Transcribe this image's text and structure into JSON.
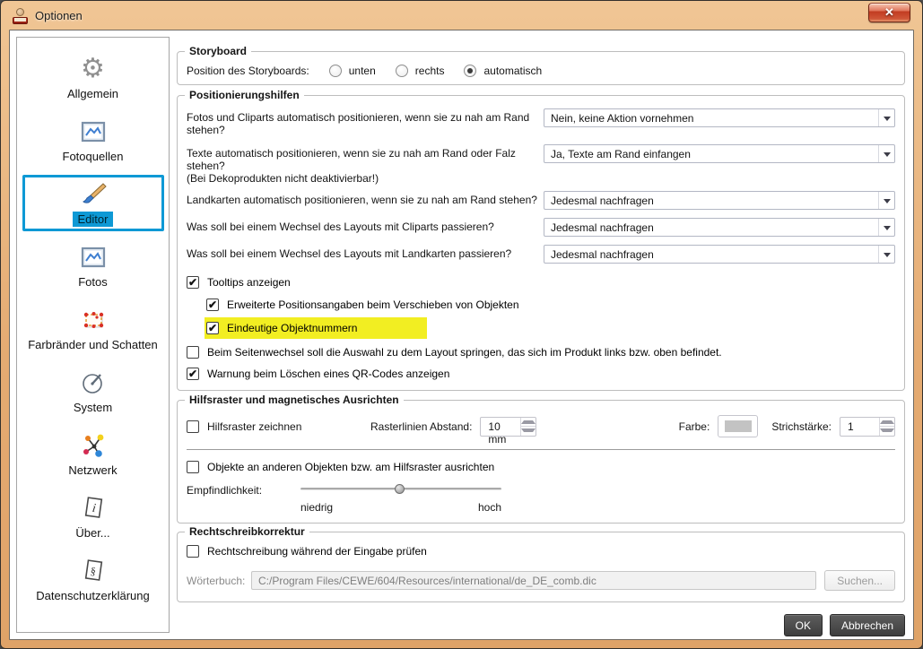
{
  "window": {
    "title": "Optionen",
    "close": "x"
  },
  "colors": {
    "accent_blue": "#0e99d5",
    "highlight_yellow": "#f2ee22",
    "titlebar_orange": "#e5ab72",
    "close_red": "#c23c22",
    "dark_button": "#4a4a4a",
    "grid_color_swatch": "#c3c3c3"
  },
  "sidebar": {
    "items": [
      {
        "label": "Allgemein",
        "icon": "gear-icon",
        "selected": false
      },
      {
        "label": "Fotoquellen",
        "icon": "image-icon",
        "selected": false
      },
      {
        "label": "Editor",
        "icon": "brush-icon",
        "selected": true
      },
      {
        "label": "Fotos",
        "icon": "image-icon",
        "selected": false
      },
      {
        "label": "Farbränder und Schatten",
        "icon": "selection-frame-icon",
        "selected": false
      },
      {
        "label": "System",
        "icon": "gauge-icon",
        "selected": false
      },
      {
        "label": "Netzwerk",
        "icon": "network-icon",
        "selected": false
      },
      {
        "label": "Über...",
        "icon": "info-page-icon",
        "selected": false
      },
      {
        "label": "Datenschutzerklärung",
        "icon": "paragraph-page-icon",
        "selected": false
      }
    ]
  },
  "storyboard": {
    "title": "Storyboard",
    "label": "Position des Storyboards:",
    "options": [
      {
        "label": "unten",
        "selected": false
      },
      {
        "label": "rechts",
        "selected": false
      },
      {
        "label": "automatisch",
        "selected": true
      }
    ]
  },
  "positioning": {
    "title": "Positionierungshilfen",
    "rows": [
      {
        "label": "Fotos und Cliparts automatisch positionieren, wenn sie zu nah am Rand stehen?",
        "sublabel": "",
        "value": "Nein, keine Aktion vornehmen"
      },
      {
        "label": "Texte automatisch positionieren, wenn sie zu nah am Rand oder Falz stehen?",
        "sublabel": "(Bei Dekoprodukten nicht deaktivierbar!)",
        "value": "Ja, Texte am Rand einfangen"
      },
      {
        "label": "Landkarten automatisch positionieren, wenn sie zu nah am Rand stehen?",
        "sublabel": "",
        "value": "Jedesmal nachfragen"
      },
      {
        "label": "Was soll bei einem Wechsel des Layouts mit Cliparts passieren?",
        "sublabel": "",
        "value": "Jedesmal nachfragen"
      },
      {
        "label": "Was soll bei einem Wechsel des Layouts mit Landkarten passieren?",
        "sublabel": "",
        "value": "Jedesmal nachfragen"
      }
    ],
    "checkboxes": [
      {
        "label": "Tooltips anzeigen",
        "checked": true,
        "indent": false,
        "highlighted": false
      },
      {
        "label": "Erweiterte Positionsangaben beim Verschieben von Objekten",
        "checked": true,
        "indent": true,
        "highlighted": false
      },
      {
        "label": "Eindeutige Objektnummern",
        "checked": true,
        "indent": true,
        "highlighted": true
      },
      {
        "label": "Beim Seitenwechsel soll die Auswahl zu dem Layout springen, das sich im Produkt links bzw. oben befindet.",
        "checked": false,
        "indent": false,
        "highlighted": false
      },
      {
        "label": "Warnung beim Löschen eines QR-Codes anzeigen",
        "checked": true,
        "indent": false,
        "highlighted": false
      }
    ]
  },
  "grid": {
    "title": "Hilfsraster und magnetisches Ausrichten",
    "draw_checkbox": {
      "label": "Hilfsraster zeichnen",
      "checked": false
    },
    "spacing_label": "Rasterlinien Abstand:",
    "spacing_value": "10 mm",
    "color_label": "Farbe:",
    "stroke_label": "Strichstärke:",
    "stroke_value": "1",
    "snap_checkbox": {
      "label": "Objekte an anderen Objekten bzw. am Hilfsraster ausrichten",
      "checked": false
    },
    "sensitivity_label": "Empfindlichkeit:",
    "slider_percent": 49,
    "slider_min_label": "niedrig",
    "slider_max_label": "hoch"
  },
  "spelling": {
    "title": "Rechtschreibkorrektur",
    "check": {
      "label": "Rechtschreibung während der Eingabe prüfen",
      "checked": false
    },
    "dict_label": "Wörterbuch:",
    "dict_value": "C:/Program Files/CEWE/604/Resources/international/de_DE_comb.dic",
    "browse_label": "Suchen..."
  },
  "footer": {
    "ok": "OK",
    "cancel": "Abbrechen"
  }
}
